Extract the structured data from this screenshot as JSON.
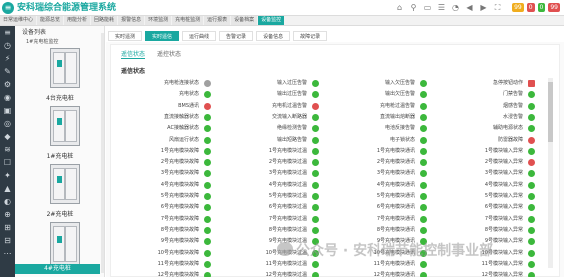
{
  "header": {
    "logo_glyph": "≡",
    "title": "安科瑞综合能源管理系统",
    "icons": [
      "⌂",
      "⚲",
      "▭",
      "☰",
      "◔",
      "◀",
      "▶",
      "⛶"
    ],
    "badges": [
      {
        "text": "99",
        "color": "#f0ad1e"
      },
      {
        "text": "0",
        "color": "#e05050"
      },
      {
        "text": "0",
        "color": "#3cb83c"
      },
      {
        "text": "99",
        "color": "#e05050"
      }
    ]
  },
  "nav": {
    "tabs": [
      "日常运维中心",
      "能源总览",
      "用能分析",
      "回路能耗",
      "报警信息",
      "环境监测",
      "充电桩监测",
      "运行报表",
      "设备档案",
      "设备监控"
    ],
    "active_index": 9
  },
  "sidebar_icons": [
    "≡",
    "◷",
    "⚡",
    "✎",
    "⚙",
    "◉",
    "▣",
    "◎",
    "◆",
    "≋",
    "☐",
    "✦",
    "▲",
    "◐",
    "⊕",
    "⊞",
    "⊟",
    "⋯"
  ],
  "equipment": {
    "header": "设备列表",
    "subheader": "1#充电桩监控",
    "items": [
      {
        "label": "4台充电桩"
      },
      {
        "label": "1#充电桩"
      },
      {
        "label": "2#充电桩"
      },
      {
        "label": "3#充电桩"
      }
    ],
    "footer": "4#充电桩"
  },
  "panel_tabs": [
    "实时遥测",
    "实时遥信",
    "运行曲线",
    "告警记录",
    "设备信息",
    "故障记录"
  ],
  "active_panel_tab": 1,
  "subtabs": [
    "遥信状态",
    "遥控状态"
  ],
  "section_title": "遥信状态",
  "status_grid": [
    [
      {
        "label": "充电枪连接状态",
        "state": "gray"
      },
      {
        "label": "输入过压告警",
        "state": "green"
      },
      {
        "label": "输入欠压告警",
        "state": "green"
      },
      {
        "label": "急停按钮动作",
        "state": "red-sq"
      }
    ],
    [
      {
        "label": "充电状态",
        "state": "green"
      },
      {
        "label": "输出过压告警",
        "state": "green"
      },
      {
        "label": "输出欠压告警",
        "state": "green"
      },
      {
        "label": "门禁告警",
        "state": "green"
      }
    ],
    [
      {
        "label": "BMS通讯",
        "state": "red"
      },
      {
        "label": "充电机过温告警",
        "state": "red"
      },
      {
        "label": "充电枪过温告警",
        "state": "green"
      },
      {
        "label": "烟感告警",
        "state": "green"
      }
    ],
    [
      {
        "label": "直流接触器状态",
        "state": "green"
      },
      {
        "label": "交流输入断路器",
        "state": "green"
      },
      {
        "label": "直流输出熔断器",
        "state": "green"
      },
      {
        "label": "水浸告警",
        "state": "green"
      }
    ],
    [
      {
        "label": "AC接触器状态",
        "state": "green"
      },
      {
        "label": "绝缘检测告警",
        "state": "green"
      },
      {
        "label": "电池反接告警",
        "state": "green"
      },
      {
        "label": "辅助电源状态",
        "state": "green"
      }
    ],
    [
      {
        "label": "风扇运行状态",
        "state": "green"
      },
      {
        "label": "输出短路告警",
        "state": "green"
      },
      {
        "label": "电子锁状态",
        "state": "green"
      },
      {
        "label": "防雷器故障",
        "state": "red"
      }
    ],
    [
      {
        "label": "1号充电模块故障",
        "state": "green"
      },
      {
        "label": "1号充电模块过温",
        "state": "green"
      },
      {
        "label": "1号充电模块通讯",
        "state": "green"
      },
      {
        "label": "1号模块输入异常",
        "state": "green"
      }
    ],
    [
      {
        "label": "2号充电模块故障",
        "state": "green"
      },
      {
        "label": "2号充电模块过温",
        "state": "green"
      },
      {
        "label": "2号充电模块通讯",
        "state": "green"
      },
      {
        "label": "2号模块输入异常",
        "state": "red"
      }
    ],
    [
      {
        "label": "3号充电模块故障",
        "state": "green"
      },
      {
        "label": "3号充电模块过温",
        "state": "green"
      },
      {
        "label": "3号充电模块通讯",
        "state": "green"
      },
      {
        "label": "3号模块输入异常",
        "state": "green"
      }
    ],
    [
      {
        "label": "4号充电模块故障",
        "state": "green"
      },
      {
        "label": "4号充电模块过温",
        "state": "green"
      },
      {
        "label": "4号充电模块通讯",
        "state": "green"
      },
      {
        "label": "4号模块输入异常",
        "state": "green"
      }
    ],
    [
      {
        "label": "5号充电模块故障",
        "state": "green"
      },
      {
        "label": "5号充电模块过温",
        "state": "green"
      },
      {
        "label": "5号充电模块通讯",
        "state": "green"
      },
      {
        "label": "5号模块输入异常",
        "state": "green"
      }
    ],
    [
      {
        "label": "6号充电模块故障",
        "state": "green"
      },
      {
        "label": "6号充电模块过温",
        "state": "green"
      },
      {
        "label": "6号充电模块通讯",
        "state": "green"
      },
      {
        "label": "6号模块输入异常",
        "state": "green"
      }
    ],
    [
      {
        "label": "7号充电模块故障",
        "state": "green"
      },
      {
        "label": "7号充电模块过温",
        "state": "green"
      },
      {
        "label": "7号充电模块通讯",
        "state": "green"
      },
      {
        "label": "7号模块输入异常",
        "state": "green"
      }
    ],
    [
      {
        "label": "8号充电模块故障",
        "state": "green"
      },
      {
        "label": "8号充电模块过温",
        "state": "green"
      },
      {
        "label": "8号充电模块通讯",
        "state": "green"
      },
      {
        "label": "8号模块输入异常",
        "state": "green"
      }
    ],
    [
      {
        "label": "9号充电模块故障",
        "state": "green"
      },
      {
        "label": "9号充电模块过温",
        "state": "green"
      },
      {
        "label": "9号充电模块通讯",
        "state": "green"
      },
      {
        "label": "9号模块输入异常",
        "state": "green"
      }
    ],
    [
      {
        "label": "10号充电模块故障",
        "state": "green"
      },
      {
        "label": "10号充电模块过温",
        "state": "green"
      },
      {
        "label": "10号充电模块通讯",
        "state": "green"
      },
      {
        "label": "10号模块输入异常",
        "state": "green"
      }
    ],
    [
      {
        "label": "11号充电模块故障",
        "state": "green"
      },
      {
        "label": "11号充电模块过温",
        "state": "green"
      },
      {
        "label": "11号充电模块通讯",
        "state": "green"
      },
      {
        "label": "11号模块输入异常",
        "state": "green"
      }
    ],
    [
      {
        "label": "12号充电模块故障",
        "state": "green"
      },
      {
        "label": "12号充电模块过温",
        "state": "green"
      },
      {
        "label": "12号充电模块通讯",
        "state": "green"
      },
      {
        "label": "12号模块输入异常",
        "state": "green"
      }
    ]
  ],
  "watermark": "公众号 · 安科瑞节能控制事业部"
}
